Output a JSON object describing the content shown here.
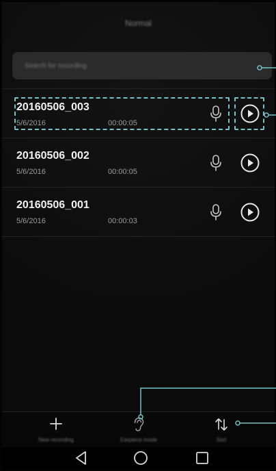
{
  "header": {
    "title": "Normal"
  },
  "search": {
    "placeholder": "Search for recording"
  },
  "recordings": [
    {
      "title": "20160506_003",
      "date": "5/6/2016",
      "duration": "00:00:05"
    },
    {
      "title": "20160506_002",
      "date": "5/6/2016",
      "duration": "00:00:05"
    },
    {
      "title": "20160506_001",
      "date": "5/6/2016",
      "duration": "00:00:03"
    }
  ],
  "toolbar": {
    "new_recording_label": "New recording",
    "earpiece_label": "Earpiece mode",
    "sort_label": "Sort"
  },
  "icons": {
    "mic": "microphone-icon",
    "play": "play-icon",
    "add": "plus-icon",
    "earpiece": "ear-icon",
    "sort": "sort-icon",
    "back": "back-triangle-icon",
    "home": "home-circle-icon",
    "recents": "recents-square-icon"
  },
  "colors": {
    "background": "#0b0b0b",
    "search_bg": "#2b2b2b",
    "annotation": "#74c3c8",
    "text_primary": "#f2f2f2",
    "text_secondary": "#9b9b9b"
  }
}
